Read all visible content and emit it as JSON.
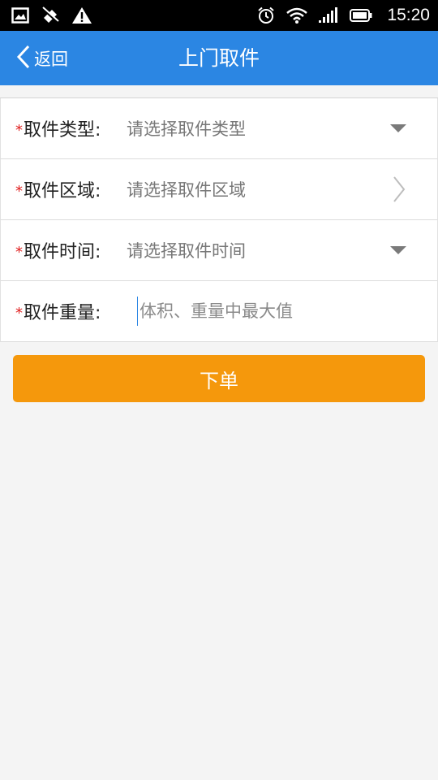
{
  "status_bar": {
    "time": "15:20",
    "left_icons": [
      "image-icon",
      "no-signal-icon",
      "warning-icon"
    ],
    "right_icons": [
      "alarm-icon",
      "wifi-icon",
      "cell-signal-icon",
      "battery-icon"
    ]
  },
  "app_bar": {
    "back_label": "返回",
    "title": "上门取件",
    "background_color": "#2b86e3"
  },
  "form": {
    "required_mark": "*",
    "fields": [
      {
        "label": "取件类型:",
        "value": "请选择取件类型",
        "control": "dropdown"
      },
      {
        "label": "取件区域:",
        "value": "请选择取件区域",
        "control": "chevron"
      },
      {
        "label": "取件时间:",
        "value": "请选择取件时间",
        "control": "dropdown"
      },
      {
        "label": "取件重量:",
        "placeholder": "体积、重量中最大值",
        "control": "text-input"
      }
    ]
  },
  "submit": {
    "label": "下单",
    "color": "#f5980c"
  }
}
